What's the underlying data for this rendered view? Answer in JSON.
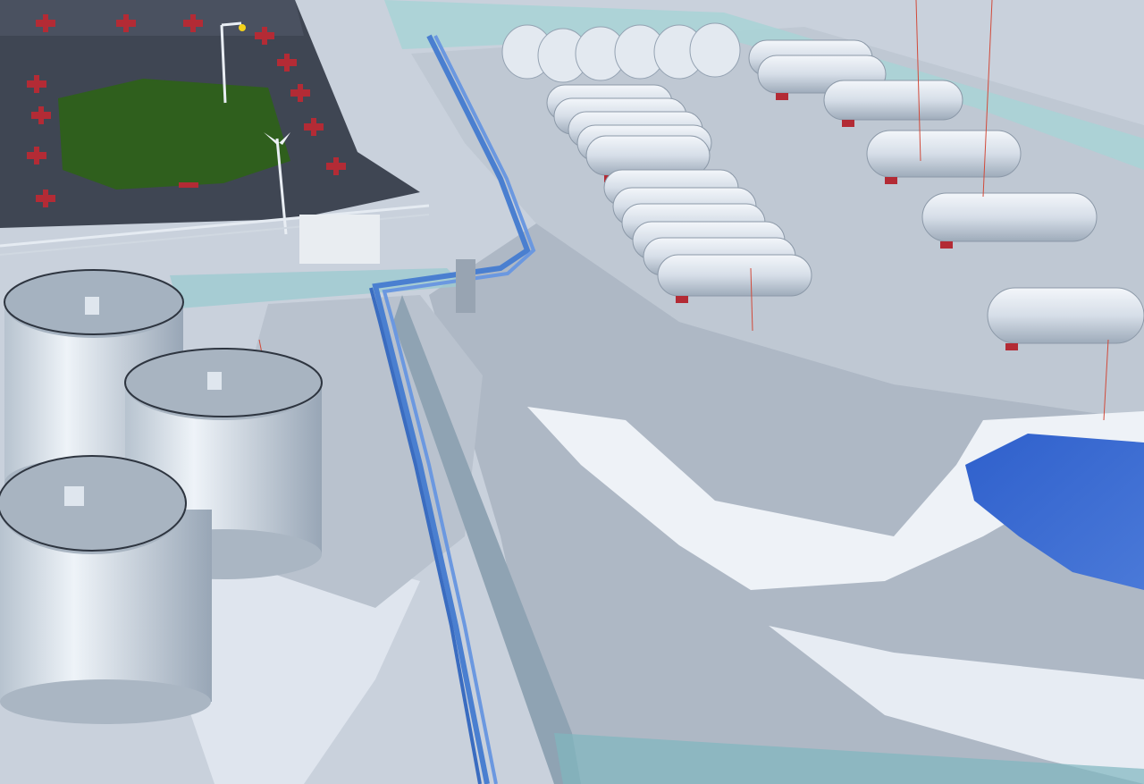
{
  "viewport": {
    "name": "3d-plant-viewport"
  },
  "colors": {
    "terrain_light": "#cfd6df",
    "terrain_mid": "#b3bcc8",
    "terrain_dark": "#8d97a6",
    "terrain_snow": "#eef2f7",
    "plaza_dark": "#3f4653",
    "green_pad": "#2f5f1d",
    "tank_body": "#d9e1ea",
    "tank_shadow": "#a9b4c1",
    "pipe_blue": "#4a7fd0",
    "pond_blue": "#3764c6",
    "wall_cyan": "#a8d3d6",
    "marker_red": "#b32b35"
  },
  "objects": {
    "storage_tanks": [
      "tank-1",
      "tank-2",
      "tank-3"
    ],
    "horizontal_tank_banks": [
      "bank-left",
      "bank-middle",
      "bank-right"
    ],
    "spheres_row": "pressurized-spheres",
    "pond": "water-pond",
    "pipe_rack": "main-pipe-rack"
  }
}
